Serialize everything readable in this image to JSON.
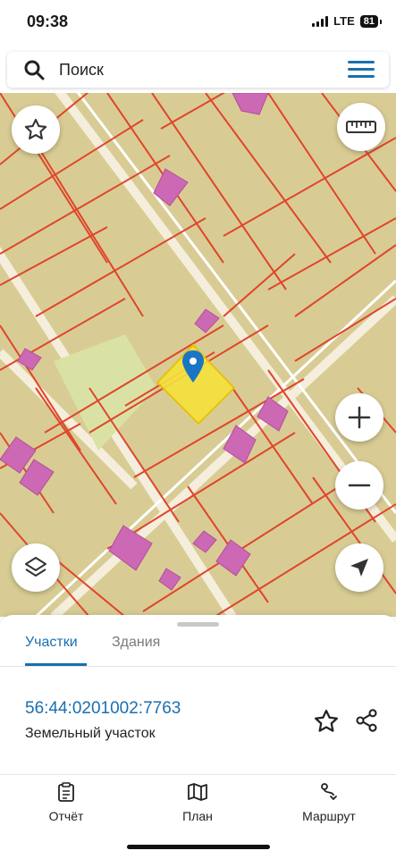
{
  "status_bar": {
    "time": "09:38",
    "network": "LTE",
    "battery": "81"
  },
  "search": {
    "placeholder": "Поиск"
  },
  "tabs": [
    {
      "label": "Участки",
      "active": true
    },
    {
      "label": "Здания",
      "active": false
    }
  ],
  "parcel": {
    "id": "56:44:0201002:7763",
    "type": "Земельный участок"
  },
  "bottom_nav": [
    {
      "label": "Отчёт",
      "icon": "report-icon"
    },
    {
      "label": "План",
      "icon": "map-icon"
    },
    {
      "label": "Маршрут",
      "icon": "route-icon"
    }
  ],
  "colors": {
    "accent": "#1a6fb0",
    "map_ground": "#d8cc94",
    "parcel_line": "#e0452c",
    "building": "#cd68b4",
    "selected": "#f5e23c"
  }
}
